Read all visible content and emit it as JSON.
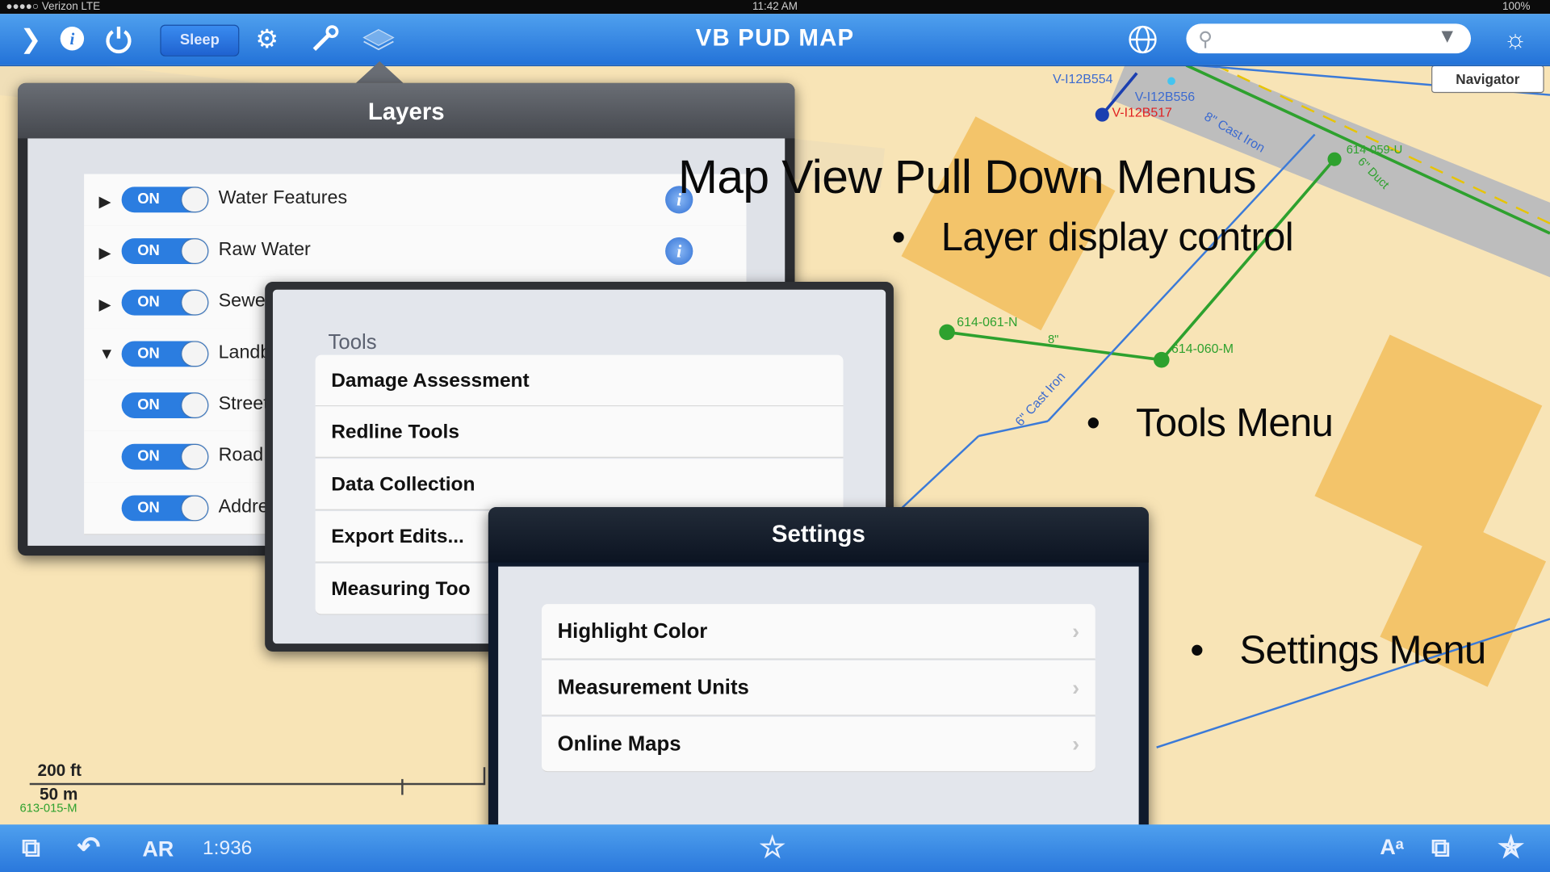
{
  "status_bar": {
    "carrier": "●●●●○ Verizon  LTE",
    "time": "11:42 AM",
    "battery": "100%"
  },
  "toolbar": {
    "title": "VB PUD MAP",
    "sleep_label": "Sleep",
    "icons": [
      "chevron-right-icon",
      "info-icon",
      "power-icon",
      "gear-icon",
      "wrench-icon",
      "layers-icon",
      "globe-icon",
      "search-icon",
      "filter-icon",
      "brightness-icon"
    ]
  },
  "map": {
    "navigator_label": "Navigator",
    "labels": [
      "V-I12B554",
      "V-I12B556",
      "V-I12B517",
      "8\" Cast Iron",
      "614-059-U",
      "6\" Duct",
      "614-061-N",
      "8\"",
      "614-060-M",
      "6\" Cast Iron",
      "613-015-M"
    ],
    "scale_ft": "200 ft",
    "scale_m": "50 m"
  },
  "layers_panel": {
    "title": "Layers",
    "toggle_label": "ON",
    "rows": [
      {
        "name": "Water Features",
        "disclosure": "▶",
        "info": true
      },
      {
        "name": "Raw Water",
        "disclosure": "▶",
        "info": true
      },
      {
        "name": "Sewe",
        "disclosure": "▶",
        "info": false
      },
      {
        "name": "Landb",
        "disclosure": "▼",
        "info": false
      },
      {
        "name": "Street",
        "disclosure": "",
        "info": false
      },
      {
        "name": "Road",
        "disclosure": "",
        "info": false
      },
      {
        "name": "Addre",
        "disclosure": "",
        "info": false
      }
    ]
  },
  "tools_panel": {
    "label": "Tools",
    "items": [
      "Damage Assessment",
      "Redline Tools",
      "Data Collection",
      "Export Edits...",
      "Measuring Too"
    ]
  },
  "settings_panel": {
    "title": "Settings",
    "items": [
      "Highlight Color",
      "Measurement Units",
      "Online Maps"
    ]
  },
  "slide": {
    "title": "Map  View Pull Down Menus",
    "bullets": [
      "Layer display control",
      "Tools Menu",
      "Settings Menu"
    ]
  },
  "bottom_bar": {
    "mode": "AR",
    "scale": "1:936"
  },
  "colors": {
    "toolbar_blue": "#2f80e3",
    "toggle_blue": "#2b7de0",
    "map_background": "#f8e4b6",
    "building": "#f3c46a",
    "water_line": "#3b7ad8",
    "sewer_line": "#2ea12e"
  }
}
